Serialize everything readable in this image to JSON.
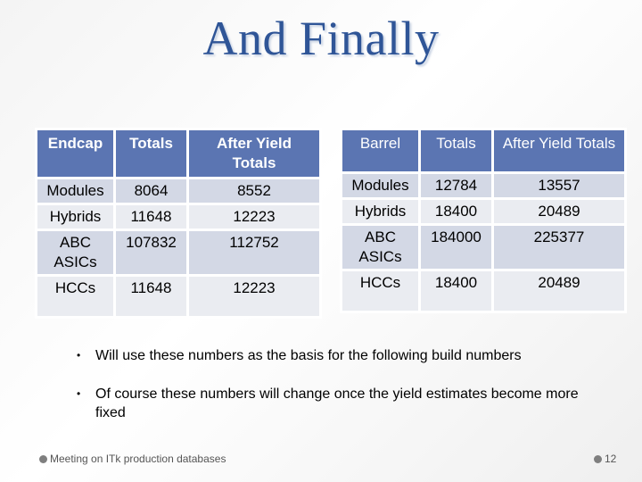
{
  "slide": {
    "title": "And Finally",
    "endcap_table": {
      "headers": [
        "Endcap",
        "Totals",
        "After Yield Totals"
      ],
      "rows": [
        [
          "Modules",
          "8064",
          "8552"
        ],
        [
          "Hybrids",
          "11648",
          "12223"
        ],
        [
          "ABC ASICs",
          "107832",
          "112752"
        ],
        [
          "HCCs",
          "11648",
          "12223"
        ]
      ]
    },
    "barrel_table": {
      "headers": [
        "Barrel",
        "Totals",
        "After Yield Totals"
      ],
      "rows": [
        [
          "Modules",
          "12784",
          "13557"
        ],
        [
          "Hybrids",
          "18400",
          "20489"
        ],
        [
          "ABC ASICs",
          "184000",
          "225377"
        ],
        [
          "HCCs",
          "18400",
          "20489"
        ]
      ]
    },
    "bullets": [
      "Will use these numbers as the basis for the following build numbers",
      "Of course these numbers will change once the yield estimates become more fixed"
    ],
    "bullet_glyph": "•",
    "footer": {
      "text": "Meeting on ITk production databases",
      "page_number": "12"
    },
    "colors": {
      "title": "#2f5597",
      "header_bg": "#5b75b2",
      "row_odd": "#d3d8e5",
      "row_even": "#eaecf1"
    }
  }
}
